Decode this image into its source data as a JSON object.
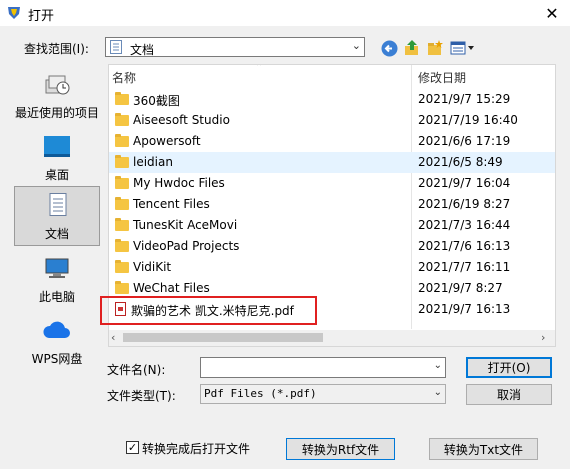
{
  "window": {
    "title": "打开",
    "close_glyph": "✕"
  },
  "lookin": {
    "label": "查找范围(I):",
    "value": "文档"
  },
  "places": [
    {
      "label": "最近使用的项目",
      "icon": "recent-items-icon"
    },
    {
      "label": "桌面",
      "icon": "desktop-icon"
    },
    {
      "label": "文档",
      "icon": "documents-icon",
      "selected": true
    },
    {
      "label": "此电脑",
      "icon": "this-pc-icon"
    },
    {
      "label": "WPS网盘",
      "icon": "wps-cloud-icon"
    }
  ],
  "list": {
    "col_name": "名称",
    "col_date": "修改日期",
    "rows": [
      {
        "name": "360截图",
        "date": "2021/9/7 15:29",
        "type": "folder"
      },
      {
        "name": "Aiseesoft Studio",
        "date": "2021/7/19 16:40",
        "type": "folder"
      },
      {
        "name": "Apowersoft",
        "date": "2021/6/6 17:19",
        "type": "folder"
      },
      {
        "name": "leidian",
        "date": "2021/6/5 8:49",
        "type": "folder",
        "highlight": true
      },
      {
        "name": "My Hwdoc Files",
        "date": "2021/9/7 16:04",
        "type": "folder"
      },
      {
        "name": "Tencent Files",
        "date": "2021/6/19 8:27",
        "type": "folder"
      },
      {
        "name": "TunesKit AceMovi",
        "date": "2021/7/3 16:44",
        "type": "folder"
      },
      {
        "name": "VideoPad Projects",
        "date": "2021/7/6 16:13",
        "type": "folder"
      },
      {
        "name": "VidiKit",
        "date": "2021/7/7 16:11",
        "type": "folder"
      },
      {
        "name": "WeChat Files",
        "date": "2021/9/7 8:27",
        "type": "folder"
      },
      {
        "name": "欺骗的艺术 凯文.米特尼克.pdf",
        "date": "2021/9/7 16:13",
        "type": "pdf"
      }
    ]
  },
  "filename": {
    "label": "文件名(N):",
    "value": ""
  },
  "filetype": {
    "label": "文件类型(T):",
    "value": "Pdf Files (*.pdf)"
  },
  "buttons": {
    "open": "打开(O)",
    "cancel": "取消",
    "to_rtf": "转换为Rtf文件",
    "to_txt": "转换为Txt文件"
  },
  "checkbox": {
    "label": "转换完成后打开文件",
    "checked": true,
    "mark": "✓"
  },
  "colors": {
    "accent": "#0078d7",
    "highlight_row": "#e5f3ff",
    "annotation_box": "#e02020"
  }
}
